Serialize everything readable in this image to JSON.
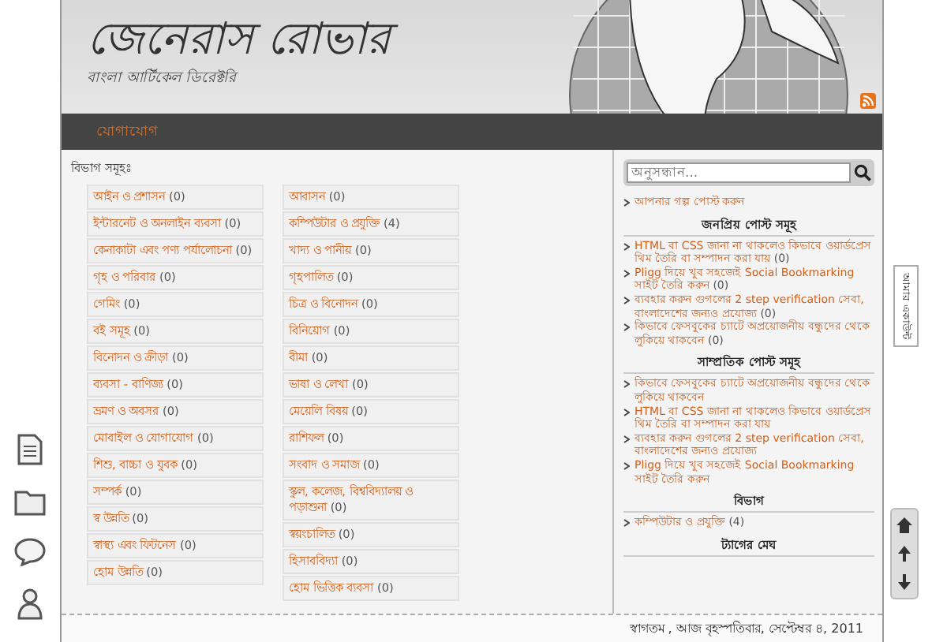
{
  "header": {
    "title": "জেনেরাস রোভার",
    "subtitle": "বাংলা আর্টিকেল ডিরেক্টরি"
  },
  "nav": [
    {
      "label": "যোগাযোগ",
      "selected": false
    }
  ],
  "categories_heading": "বিভাগ সমূহঃ",
  "categories": [
    [
      {
        "label": "আইন ও প্রশাসন",
        "count": "(0)"
      },
      {
        "label": "ইন্টারনেট ও অনলাইন ব্যবসা",
        "count": "(0)"
      },
      {
        "label": "কেনাকাটা এবং পণ্য পর্যালোচনা",
        "count": "(0)"
      },
      {
        "label": "গৃহ ও পরিবার",
        "count": "(0)"
      },
      {
        "label": "গেমিং",
        "count": "(0)"
      },
      {
        "label": "বই সমূহ",
        "count": "(0)"
      },
      {
        "label": "বিনোদন ও ক্রীড়া",
        "count": "(0)"
      },
      {
        "label": "ব্যবসা - বাণিজ্য",
        "count": "(0)"
      },
      {
        "label": "ভ্রমণ ও অবসর",
        "count": "(0)"
      },
      {
        "label": "মোবাইল ও যোগাযোগ",
        "count": "(0)"
      },
      {
        "label": "শিশু, বাচ্চা ও যুবক",
        "count": "(0)"
      },
      {
        "label": "সম্পর্ক",
        "count": "(0)"
      },
      {
        "label": "স্ব উন্নতি",
        "count": "(0)"
      },
      {
        "label": "স্বাস্থ্য এবং ফিটনেস",
        "count": "(0)"
      },
      {
        "label": "হোম উন্নতি",
        "count": "(0)"
      }
    ],
    [
      {
        "label": "আবাসন",
        "count": "(0)"
      },
      {
        "label": "কম্পিউটার ও প্রযুক্তি",
        "count": "(4)"
      },
      {
        "label": "খাদ্য ও পানীয়",
        "count": "(0)"
      },
      {
        "label": "গৃহপালিত",
        "count": "(0)"
      },
      {
        "label": "চিত্র ও বিনোদন",
        "count": "(0)"
      },
      {
        "label": "বিনিয়োগ",
        "count": "(0)"
      },
      {
        "label": "বীমা",
        "count": "(0)"
      },
      {
        "label": "ভাষা ও লেখা",
        "count": "(0)"
      },
      {
        "label": "মেয়েলি বিষয়",
        "count": "(0)"
      },
      {
        "label": "রাশিফল",
        "count": "(0)"
      },
      {
        "label": "সংবাদ ও সমাজ",
        "count": "(0)"
      },
      {
        "label": "স্কুল, কলেজ, বিশ্ববিদ্যালয় ও পড়াশুনা",
        "count": "(0)"
      },
      {
        "label": "স্বয়ংচালিত",
        "count": "(0)"
      },
      {
        "label": "হিসাববিদ্যা",
        "count": "(0)"
      },
      {
        "label": "হোম ভিত্তিক ব্যবসা",
        "count": "(0)"
      }
    ]
  ],
  "search": {
    "placeholder": "অনুসন্ধান..."
  },
  "post_link": "আপনার গল্প পোস্ট করুন",
  "widgets": [
    {
      "title": "জনপ্রিয় পোস্ট সমূহ",
      "items": [
        {
          "label": "HTML বা CSS জানা না থাকলেও কিভাবে ওয়ার্ডপ্রেস থিম তৈরি বা সম্পাদন করা যায়",
          "count": "(0)"
        },
        {
          "label": "Pligg দিয়ে খুব সহজেই Social Bookmarking সাইট তৈরি করুন",
          "count": "(0)"
        },
        {
          "label": "ব্যবহার করুন গুগলের 2 step verification সেবা, বাংলাদেশের জন্যও প্রযোজ্য",
          "count": "(0)"
        },
        {
          "label": "কিভাবে ফেসবুকের চ্যাটে অপ্রয়োজনীয় বন্ধুদের থেকে লুকিয়ে থাকবেন",
          "count": "(0)"
        }
      ]
    },
    {
      "title": "সাম্প্রতিক পোস্ট সমূহ",
      "items": [
        {
          "label": "কিভাবে ফেসবুকের চ্যাটে অপ্রয়োজনীয় বন্ধুদের থেকে লুকিয়ে থাকবেন"
        },
        {
          "label": "HTML বা CSS জানা না থাকলেও কিভাবে ওয়ার্ডপ্রেস থিম তৈরি বা সম্পাদন করা যায়"
        },
        {
          "label": "ব্যবহার করুন গুগলের 2 step verification সেবা, বাংলাদেশের জন্যও প্রযোজ্য"
        },
        {
          "label": "Pligg দিয়ে খুব সহজেই Social Bookmarking সাইট তৈরি করুন"
        }
      ]
    },
    {
      "title": "বিভাগ",
      "items": [
        {
          "label": "কম্পিউটার ও প্রযুক্তি",
          "count": "(4)"
        }
      ]
    },
    {
      "title": "ট্যাগের মেঘ"
    }
  ],
  "footer": "স্বাগতম , আজ বৃহস্পতিবার, সেপ্টেম্বর ৪, 2011",
  "account_tab": "আমার একাউন্ট"
}
